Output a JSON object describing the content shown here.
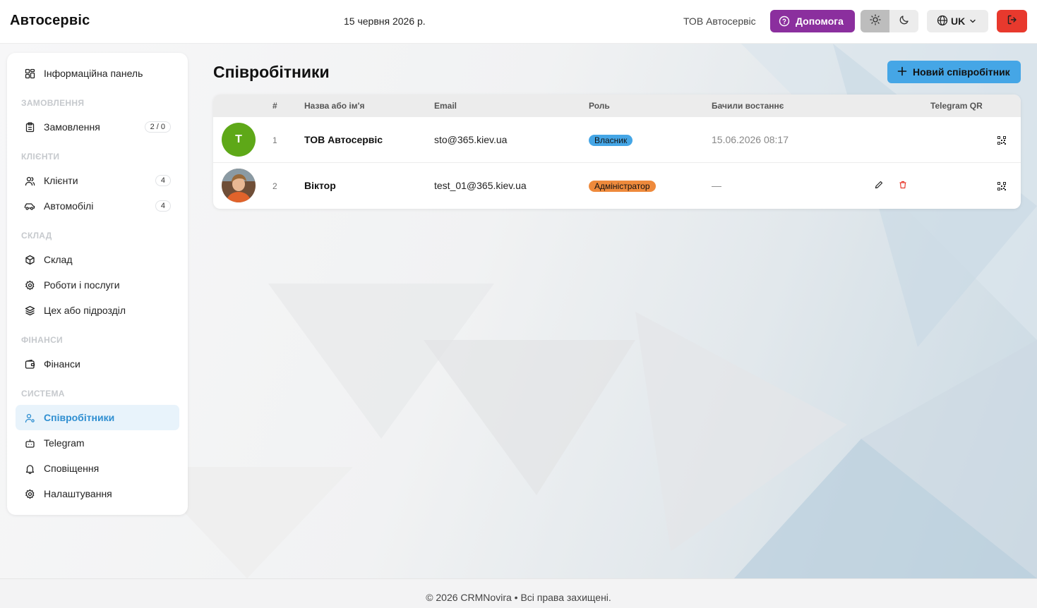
{
  "header": {
    "brand": "Автосервіс",
    "date": "15 червня 2026 р.",
    "company": "ТОВ Автосервіс",
    "help_label": "Допомога",
    "lang_label": "UK"
  },
  "sidebar": {
    "dashboard": "Інформаційна панель",
    "sections": {
      "orders": "ЗАМОВЛЕННЯ",
      "clients": "КЛІЄНТИ",
      "warehouse": "СКЛАД",
      "finance": "ФІНАНСИ",
      "system": "СИСТЕМА"
    },
    "items": {
      "orders": {
        "label": "Замовлення",
        "badge": "2 / 0"
      },
      "clients": {
        "label": "Клієнти",
        "badge": "4"
      },
      "cars": {
        "label": "Автомобілі",
        "badge": "4"
      },
      "warehouse": {
        "label": "Склад"
      },
      "services": {
        "label": "Роботи і послуги"
      },
      "departments": {
        "label": "Цех або підрозділ"
      },
      "finance": {
        "label": "Фінанси"
      },
      "employees": {
        "label": "Співробітники"
      },
      "telegram": {
        "label": "Telegram"
      },
      "notifications": {
        "label": "Сповіщення"
      },
      "settings": {
        "label": "Налаштування"
      }
    }
  },
  "main": {
    "title": "Співробітники",
    "new_button": "Новий співробітник",
    "columns": {
      "num": "#",
      "name": "Назва або ім'я",
      "email": "Email",
      "role": "Роль",
      "last_seen": "Бачили востаннє",
      "telegram_qr": "Telegram QR"
    },
    "rows": [
      {
        "avatar_letter": "Т",
        "num": "1",
        "name": "ТОВ Автосервіс",
        "email": "sto@365.kiev.ua",
        "role": "Власник",
        "last_seen": "15.06.2026 08:17"
      },
      {
        "avatar_letter": "",
        "num": "2",
        "name": "Віктор",
        "email": "test_01@365.kiev.ua",
        "role": "Адміністратор",
        "last_seen": "—"
      }
    ]
  },
  "footer": {
    "text": "© 2026 CRMNovira • Всі права захищені."
  },
  "colors": {
    "accent": "#45a6e6",
    "help": "#8b2f9e",
    "logout": "#e8392d",
    "owner_badge": "#45a6e6",
    "admin_badge": "#ee8a3c",
    "avatar_green": "#5ea818"
  }
}
